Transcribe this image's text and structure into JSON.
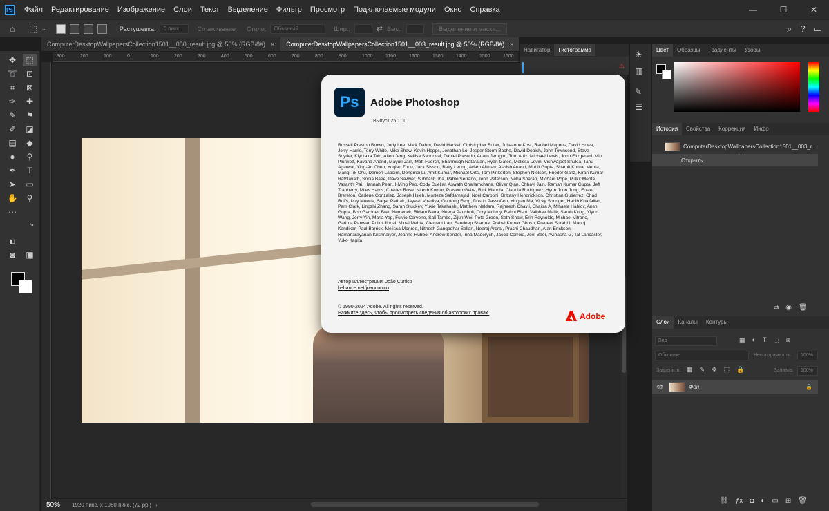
{
  "titlebar": {
    "app_icon": "Ps",
    "menu": [
      "Файл",
      "Редактирование",
      "Изображение",
      "Слои",
      "Текст",
      "Выделение",
      "Фильтр",
      "Просмотр",
      "Подключаемые модули",
      "Окно",
      "Справка"
    ],
    "window_buttons": [
      "—",
      "☐",
      "✕"
    ]
  },
  "options": {
    "feather_label": "Растушевка:",
    "feather_value": "0 пикс.",
    "antialias_label": "Сглаживание",
    "style_label": "Стили:",
    "style_value": "Обычный",
    "width_label": "Шир.:",
    "height_label": "Выс.:",
    "select_mask_button": "Выделение и маска..."
  },
  "tabs": [
    {
      "label": "ComputerDesktopWallpapersCollection1501__050_result.jpg @ 50% (RGB/8#)",
      "active": false
    },
    {
      "label": "ComputerDesktopWallpapersCollection1501__003_result.jpg @ 50% (RGB/8#)",
      "active": true
    }
  ],
  "tab_close": "×",
  "ruler_ticks": [
    "300",
    "200",
    "100",
    "0",
    "100",
    "200",
    "300",
    "400",
    "500",
    "600",
    "700",
    "800",
    "900",
    "1000",
    "1100",
    "1200",
    "1300",
    "1400",
    "1500",
    "1600"
  ],
  "status": {
    "zoom": "50%",
    "doc_info": "1920 пикс. x 1080 пикс. (72 ppi)"
  },
  "mid_panel": {
    "tabs": [
      "Навигатор",
      "Гистограмма"
    ],
    "active_tab": "Гистограмма"
  },
  "color_panel": {
    "tabs": [
      "Цвет",
      "Образцы",
      "Градиенты",
      "Узоры"
    ],
    "fg_color": "#000000",
    "bg_color": "#ffffff"
  },
  "history_panel": {
    "tabs": [
      "История",
      "Свойства",
      "Коррекция",
      "Инфо"
    ],
    "snapshot_label": "ComputerDesktopWallpapersCollection1501__003_r...",
    "items": [
      "Открыть"
    ]
  },
  "layers_panel": {
    "tabs": [
      "Слои",
      "Каналы",
      "Контуры"
    ],
    "kind_placeholder": "Вид",
    "blend_mode": "Обычные",
    "opacity_label": "Непрозрачность:",
    "opacity_value": "100%",
    "lock_label": "Закрепить:",
    "fill_label": "Заливка:",
    "fill_value": "100%",
    "layers": [
      {
        "name": "Фон",
        "locked": true,
        "visible": true
      }
    ]
  },
  "about": {
    "logo": "Ps",
    "title": "Adobe Photoshop",
    "version": "Выпуск 25.11.0",
    "credits": "Russell Preston Brown, Judy Lee, Mark Dahm, David Hackel, Christopher Butler, Julieanne Kost, Rachel Magnus, David Howe, Jerry Harris, Terry White, Mike Shaw, Kevin Hopps, Jonathan Lo, Jesper Storm Bache, David Dobish, John Townsend, Steve Snyder, Kiyotaka Taki, Allen Jeng, Kellisa Sandoval, Daniel Presedo, Adam Jerugim, Tom Attix, Michael Lewis, John Fitzgerald, Min Plunkett, Kavana Anand, Mayuri Jain, Matt Fuerch, Shanmugh Natarajan, Ryan Gates, Melissa Levin, Vishwajeet Shukla, Tanu Agarwal, Ying-An Chen, Yuqian Zhou, Jack Sisson, Betty Leong, Adam Altman, Ashish Anand, Mohit Gupta, Shamit Kumar Mehta, Mang Tik Chu, Damon Lapoint, Dongmei Li, Amit Kumar, Michael Orts, Tom Pinkerton, Stephen Nielson, Frieder Ganz, Kiran Kumar Rathlavath, Sonia Baee, Dave Sawyer, Subhash Jha, Pablo Serrano, John Peterson, Neha Sharan, Michael Pope, Pulkit Mehta, Vasanth Pai, Hannah Pearl, I-Ming Pao, Cody Cuellar, Aswath Challamcharla, Oliver Qian, Chhavi Jain, Raman Kumar Gupta, Jeff Tranberry, Miles Harris, Charles Rose, Nitesh Kumar, Praveen Gelra, Rick Mandia, Claudia Rodriguez, Hyun Joon Jung, Foster Brereton, Carlene Gonzalez, Joseph Hsieh, Morteza Safdarnejad, Noel Carboni, Brittany Hendrickson, Christian Gutierrez, Chad Rolfs, Izzy Muerte, Sagar Pathak, Jayesh Viradiya, Guotong Feng, Dustin Passofaro, Yinglan Ma, Vicky Springer, Habib Khalfallah, Pam Clark, Lingzhi Zhang, Sarah Stuckey, Yukie Takahashi, Matthew Neldam, Rajneesh Chavli, Chaitra A, Mihaela Hahlov, Ansh Gupta, Bob Gardner, Brett Nemecek, Ridam Batra, Neerja Pancholi, Cory McIlroy, Rahul Bisht, Vaibhav Malik, Sarah Kong, Yiyun Wang, Jerry Yin, Maria Yap, Fulvio Cervone, Sali Tambe, Zijun Wei, Pete Green, Seth Shaw, Erin Reynolds, Michael Vitrano, Garima Panwar, Pulkit Jindal, Minal Mehta, Clement Lan, Sandeep Sharma, Prabal Kumar Ghosh, Praneet Surabhi, Manoj Kandikar, Paul Barrick, Melissa Monroe, Nithesh Gangadhar Salian, Neeraj Arora., Prachi Chaudhari, Alan Erickson, Ramanarayanan Krishnaiyer, Jeanne Rubbo, Andrew Sender, Irina Maderych, Jacob Correia, Joel Baer, Avinasha G, Tal Lancaster, Yuko Kagita",
    "artist": "Автор иллюстрации: João Cunico",
    "artist_link": "behance.net/joaocunico",
    "copyright": "© 1990-2024 Adobe. All rights reserved.",
    "copyright_link": "Нажмите здесь, чтобы просмотреть сведения об авторских правах.",
    "brand": "Adobe"
  }
}
